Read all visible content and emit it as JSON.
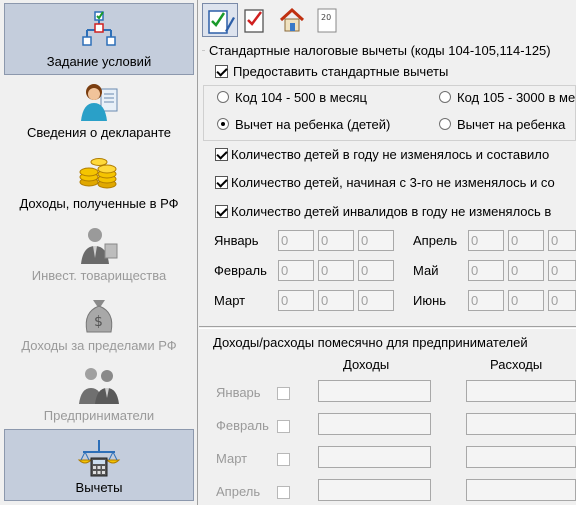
{
  "sidebar": {
    "items": [
      {
        "label": "Задание условий",
        "icon": "network-diagram-icon"
      },
      {
        "label": "Сведения о декларанте",
        "icon": "person-document-icon"
      },
      {
        "label": "Доходы, полученные в РФ",
        "icon": "gold-coins-icon"
      },
      {
        "label": "Инвест. товарищества",
        "icon": "businessman-icon"
      },
      {
        "label": "Доходы за пределами РФ",
        "icon": "money-bag-icon"
      },
      {
        "label": "Предприниматели",
        "icon": "entrepreneurs-icon"
      },
      {
        "label": "Вычеты",
        "icon": "scales-calculator-icon"
      }
    ]
  },
  "toolbar": {
    "buttons": [
      {
        "icon": "checklist-pen-icon"
      },
      {
        "icon": "checklist-icon"
      },
      {
        "icon": "house-icon"
      },
      {
        "icon": "form-20-icon",
        "label": "20"
      }
    ]
  },
  "standard": {
    "title": "Стандартные налоговые вычеты (коды 104-105,114-125)",
    "provide_label": "Предоставить стандартные вычеты",
    "code104": "Код 104 - 500 в месяц",
    "code105": "Код 105 - 3000 в ме",
    "child_deduction": "Вычет на ребенка (детей)",
    "child_deduction2": "Вычет на ребенка",
    "kids_unchanged": "Количество детей в году не изменялось и составило",
    "kids_3rd_unchanged": "Количество детей, начиная с 3-го не изменялось и со",
    "disabled_kids_unchanged": "Количество детей инвалидов в году не изменялось в",
    "months": {
      "jan": "Январь",
      "feb": "Февраль",
      "mar": "Март",
      "apr": "Апрель",
      "may": "Май",
      "jun": "Июнь"
    },
    "zero": "0"
  },
  "entrepreneur": {
    "title": "Доходы/расходы помесячно для предпринимателей",
    "income_header": "Доходы",
    "expense_header": "Расходы",
    "months": [
      "Январь",
      "Февраль",
      "Март",
      "Апрель"
    ]
  }
}
